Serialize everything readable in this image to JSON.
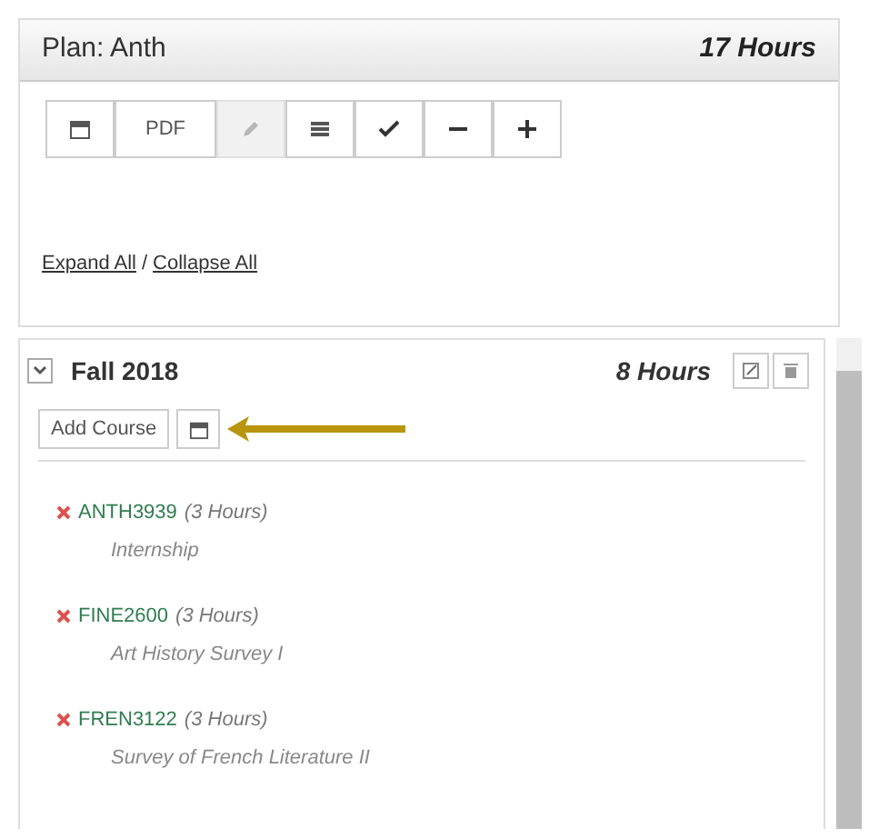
{
  "plan": {
    "title": "Plan: Anth",
    "hours": "17 Hours"
  },
  "toolbar": [
    {
      "kind": "calendar",
      "disabled": false
    },
    {
      "kind": "text",
      "label": "PDF",
      "disabled": false
    },
    {
      "kind": "pencil",
      "disabled": true
    },
    {
      "kind": "list",
      "disabled": false
    },
    {
      "kind": "check",
      "disabled": false
    },
    {
      "kind": "minus",
      "disabled": false
    },
    {
      "kind": "plus",
      "disabled": false
    }
  ],
  "links": {
    "expand": "Expand All",
    "separator": "/",
    "collapse": "Collapse All"
  },
  "term": {
    "name": "Fall 2018",
    "hours": "8 Hours",
    "expanded": true,
    "add_button": "Add Course",
    "courses": [
      {
        "code": "ANTH3939",
        "hours": "(3 Hours)",
        "title": "Internship"
      },
      {
        "code": "FINE2600",
        "hours": "(3 Hours)",
        "title": "Art History Survey I"
      },
      {
        "code": "FREN3122",
        "hours": "(3 Hours)",
        "title": "Survey of French Literature II"
      }
    ]
  }
}
